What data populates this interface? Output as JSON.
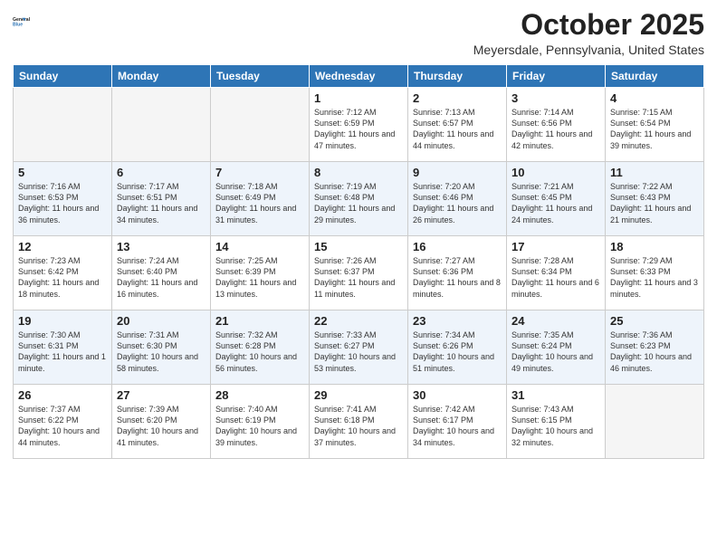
{
  "header": {
    "logo_line1": "General",
    "logo_line2": "Blue",
    "month_title": "October 2025",
    "location": "Meyersdale, Pennsylvania, United States"
  },
  "days_of_week": [
    "Sunday",
    "Monday",
    "Tuesday",
    "Wednesday",
    "Thursday",
    "Friday",
    "Saturday"
  ],
  "weeks": [
    [
      {
        "date": "",
        "info": ""
      },
      {
        "date": "",
        "info": ""
      },
      {
        "date": "",
        "info": ""
      },
      {
        "date": "1",
        "info": "Sunrise: 7:12 AM\nSunset: 6:59 PM\nDaylight: 11 hours\nand 47 minutes."
      },
      {
        "date": "2",
        "info": "Sunrise: 7:13 AM\nSunset: 6:57 PM\nDaylight: 11 hours\nand 44 minutes."
      },
      {
        "date": "3",
        "info": "Sunrise: 7:14 AM\nSunset: 6:56 PM\nDaylight: 11 hours\nand 42 minutes."
      },
      {
        "date": "4",
        "info": "Sunrise: 7:15 AM\nSunset: 6:54 PM\nDaylight: 11 hours\nand 39 minutes."
      }
    ],
    [
      {
        "date": "5",
        "info": "Sunrise: 7:16 AM\nSunset: 6:53 PM\nDaylight: 11 hours\nand 36 minutes."
      },
      {
        "date": "6",
        "info": "Sunrise: 7:17 AM\nSunset: 6:51 PM\nDaylight: 11 hours\nand 34 minutes."
      },
      {
        "date": "7",
        "info": "Sunrise: 7:18 AM\nSunset: 6:49 PM\nDaylight: 11 hours\nand 31 minutes."
      },
      {
        "date": "8",
        "info": "Sunrise: 7:19 AM\nSunset: 6:48 PM\nDaylight: 11 hours\nand 29 minutes."
      },
      {
        "date": "9",
        "info": "Sunrise: 7:20 AM\nSunset: 6:46 PM\nDaylight: 11 hours\nand 26 minutes."
      },
      {
        "date": "10",
        "info": "Sunrise: 7:21 AM\nSunset: 6:45 PM\nDaylight: 11 hours\nand 24 minutes."
      },
      {
        "date": "11",
        "info": "Sunrise: 7:22 AM\nSunset: 6:43 PM\nDaylight: 11 hours\nand 21 minutes."
      }
    ],
    [
      {
        "date": "12",
        "info": "Sunrise: 7:23 AM\nSunset: 6:42 PM\nDaylight: 11 hours\nand 18 minutes."
      },
      {
        "date": "13",
        "info": "Sunrise: 7:24 AM\nSunset: 6:40 PM\nDaylight: 11 hours\nand 16 minutes."
      },
      {
        "date": "14",
        "info": "Sunrise: 7:25 AM\nSunset: 6:39 PM\nDaylight: 11 hours\nand 13 minutes."
      },
      {
        "date": "15",
        "info": "Sunrise: 7:26 AM\nSunset: 6:37 PM\nDaylight: 11 hours\nand 11 minutes."
      },
      {
        "date": "16",
        "info": "Sunrise: 7:27 AM\nSunset: 6:36 PM\nDaylight: 11 hours\nand 8 minutes."
      },
      {
        "date": "17",
        "info": "Sunrise: 7:28 AM\nSunset: 6:34 PM\nDaylight: 11 hours\nand 6 minutes."
      },
      {
        "date": "18",
        "info": "Sunrise: 7:29 AM\nSunset: 6:33 PM\nDaylight: 11 hours\nand 3 minutes."
      }
    ],
    [
      {
        "date": "19",
        "info": "Sunrise: 7:30 AM\nSunset: 6:31 PM\nDaylight: 11 hours\nand 1 minute."
      },
      {
        "date": "20",
        "info": "Sunrise: 7:31 AM\nSunset: 6:30 PM\nDaylight: 10 hours\nand 58 minutes."
      },
      {
        "date": "21",
        "info": "Sunrise: 7:32 AM\nSunset: 6:28 PM\nDaylight: 10 hours\nand 56 minutes."
      },
      {
        "date": "22",
        "info": "Sunrise: 7:33 AM\nSunset: 6:27 PM\nDaylight: 10 hours\nand 53 minutes."
      },
      {
        "date": "23",
        "info": "Sunrise: 7:34 AM\nSunset: 6:26 PM\nDaylight: 10 hours\nand 51 minutes."
      },
      {
        "date": "24",
        "info": "Sunrise: 7:35 AM\nSunset: 6:24 PM\nDaylight: 10 hours\nand 49 minutes."
      },
      {
        "date": "25",
        "info": "Sunrise: 7:36 AM\nSunset: 6:23 PM\nDaylight: 10 hours\nand 46 minutes."
      }
    ],
    [
      {
        "date": "26",
        "info": "Sunrise: 7:37 AM\nSunset: 6:22 PM\nDaylight: 10 hours\nand 44 minutes."
      },
      {
        "date": "27",
        "info": "Sunrise: 7:39 AM\nSunset: 6:20 PM\nDaylight: 10 hours\nand 41 minutes."
      },
      {
        "date": "28",
        "info": "Sunrise: 7:40 AM\nSunset: 6:19 PM\nDaylight: 10 hours\nand 39 minutes."
      },
      {
        "date": "29",
        "info": "Sunrise: 7:41 AM\nSunset: 6:18 PM\nDaylight: 10 hours\nand 37 minutes."
      },
      {
        "date": "30",
        "info": "Sunrise: 7:42 AM\nSunset: 6:17 PM\nDaylight: 10 hours\nand 34 minutes."
      },
      {
        "date": "31",
        "info": "Sunrise: 7:43 AM\nSunset: 6:15 PM\nDaylight: 10 hours\nand 32 minutes."
      },
      {
        "date": "",
        "info": ""
      }
    ]
  ]
}
